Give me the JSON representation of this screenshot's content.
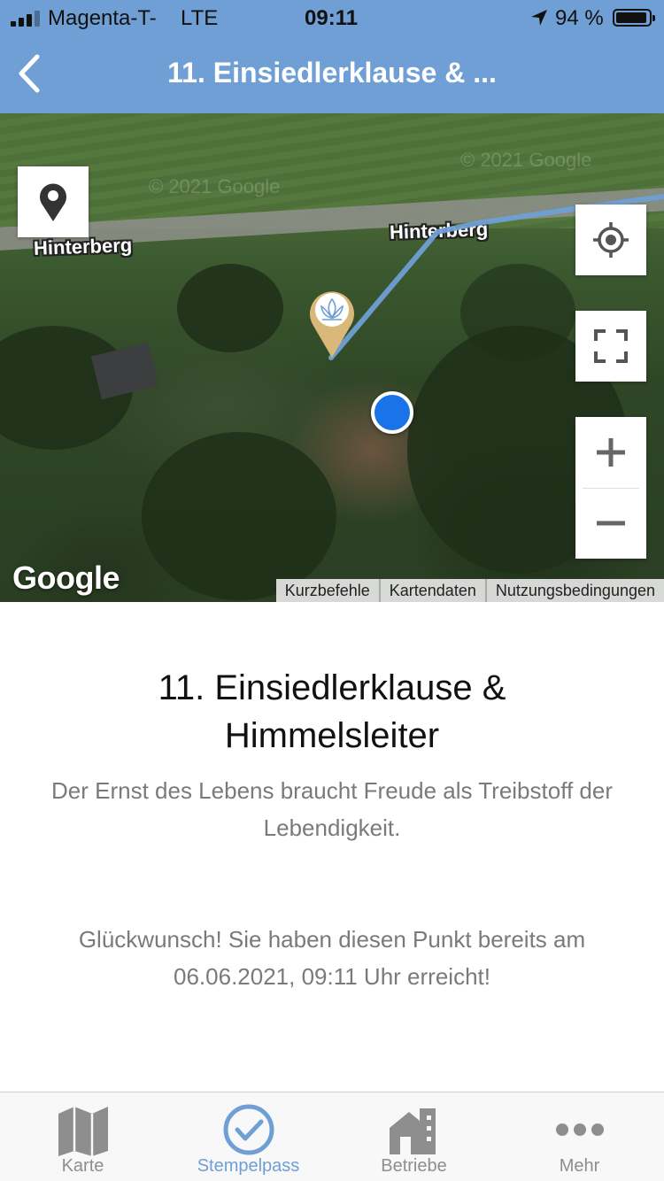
{
  "status_bar": {
    "carrier": "Magenta-T-",
    "network": "LTE",
    "time": "09:11",
    "battery": "94 %",
    "battery_level": 0.94
  },
  "nav": {
    "title": "11. Einsiedlerklause & ...",
    "back_icon": "chevron-left-icon"
  },
  "map": {
    "labels": {
      "road_left": "Hinterberg",
      "road_right": "Hinterberg"
    },
    "watermarks": [
      "© 2021 Google",
      "© 2021 Google"
    ],
    "logo": "Google",
    "attribution": [
      "Kurzbefehle",
      "Kartendaten",
      "Nutzungsbedingungen"
    ],
    "controls": {
      "pin_icon": "map-pin-icon",
      "locate_icon": "crosshair-icon",
      "fullscreen_icon": "fullscreen-icon",
      "zoom_in": "+",
      "zoom_out": "−"
    },
    "route_color": "#6f9fd4",
    "user_dot_color": "#1a73e8",
    "marker_color": "#d9b87a"
  },
  "place": {
    "title": "11. Einsiedlerklause & Himmelsleiter",
    "quote": "Der Ernst des Lebens braucht Freude als Treibstoff der Lebendigkeit.",
    "message": "Glückwunsch! Sie haben diesen Punkt bereits am 06.06.2021, 09:11 Uhr erreicht!"
  },
  "tabs": [
    {
      "label": "Karte",
      "icon": "map-icon",
      "active": false
    },
    {
      "label": "Stempelpass",
      "icon": "checkmark-circle-icon",
      "active": true
    },
    {
      "label": "Betriebe",
      "icon": "building-icon",
      "active": false
    },
    {
      "label": "Mehr",
      "icon": "more-dots-icon",
      "active": false
    }
  ],
  "colors": {
    "accent": "#6f9fd4",
    "inactive": "#8e8e8e"
  }
}
